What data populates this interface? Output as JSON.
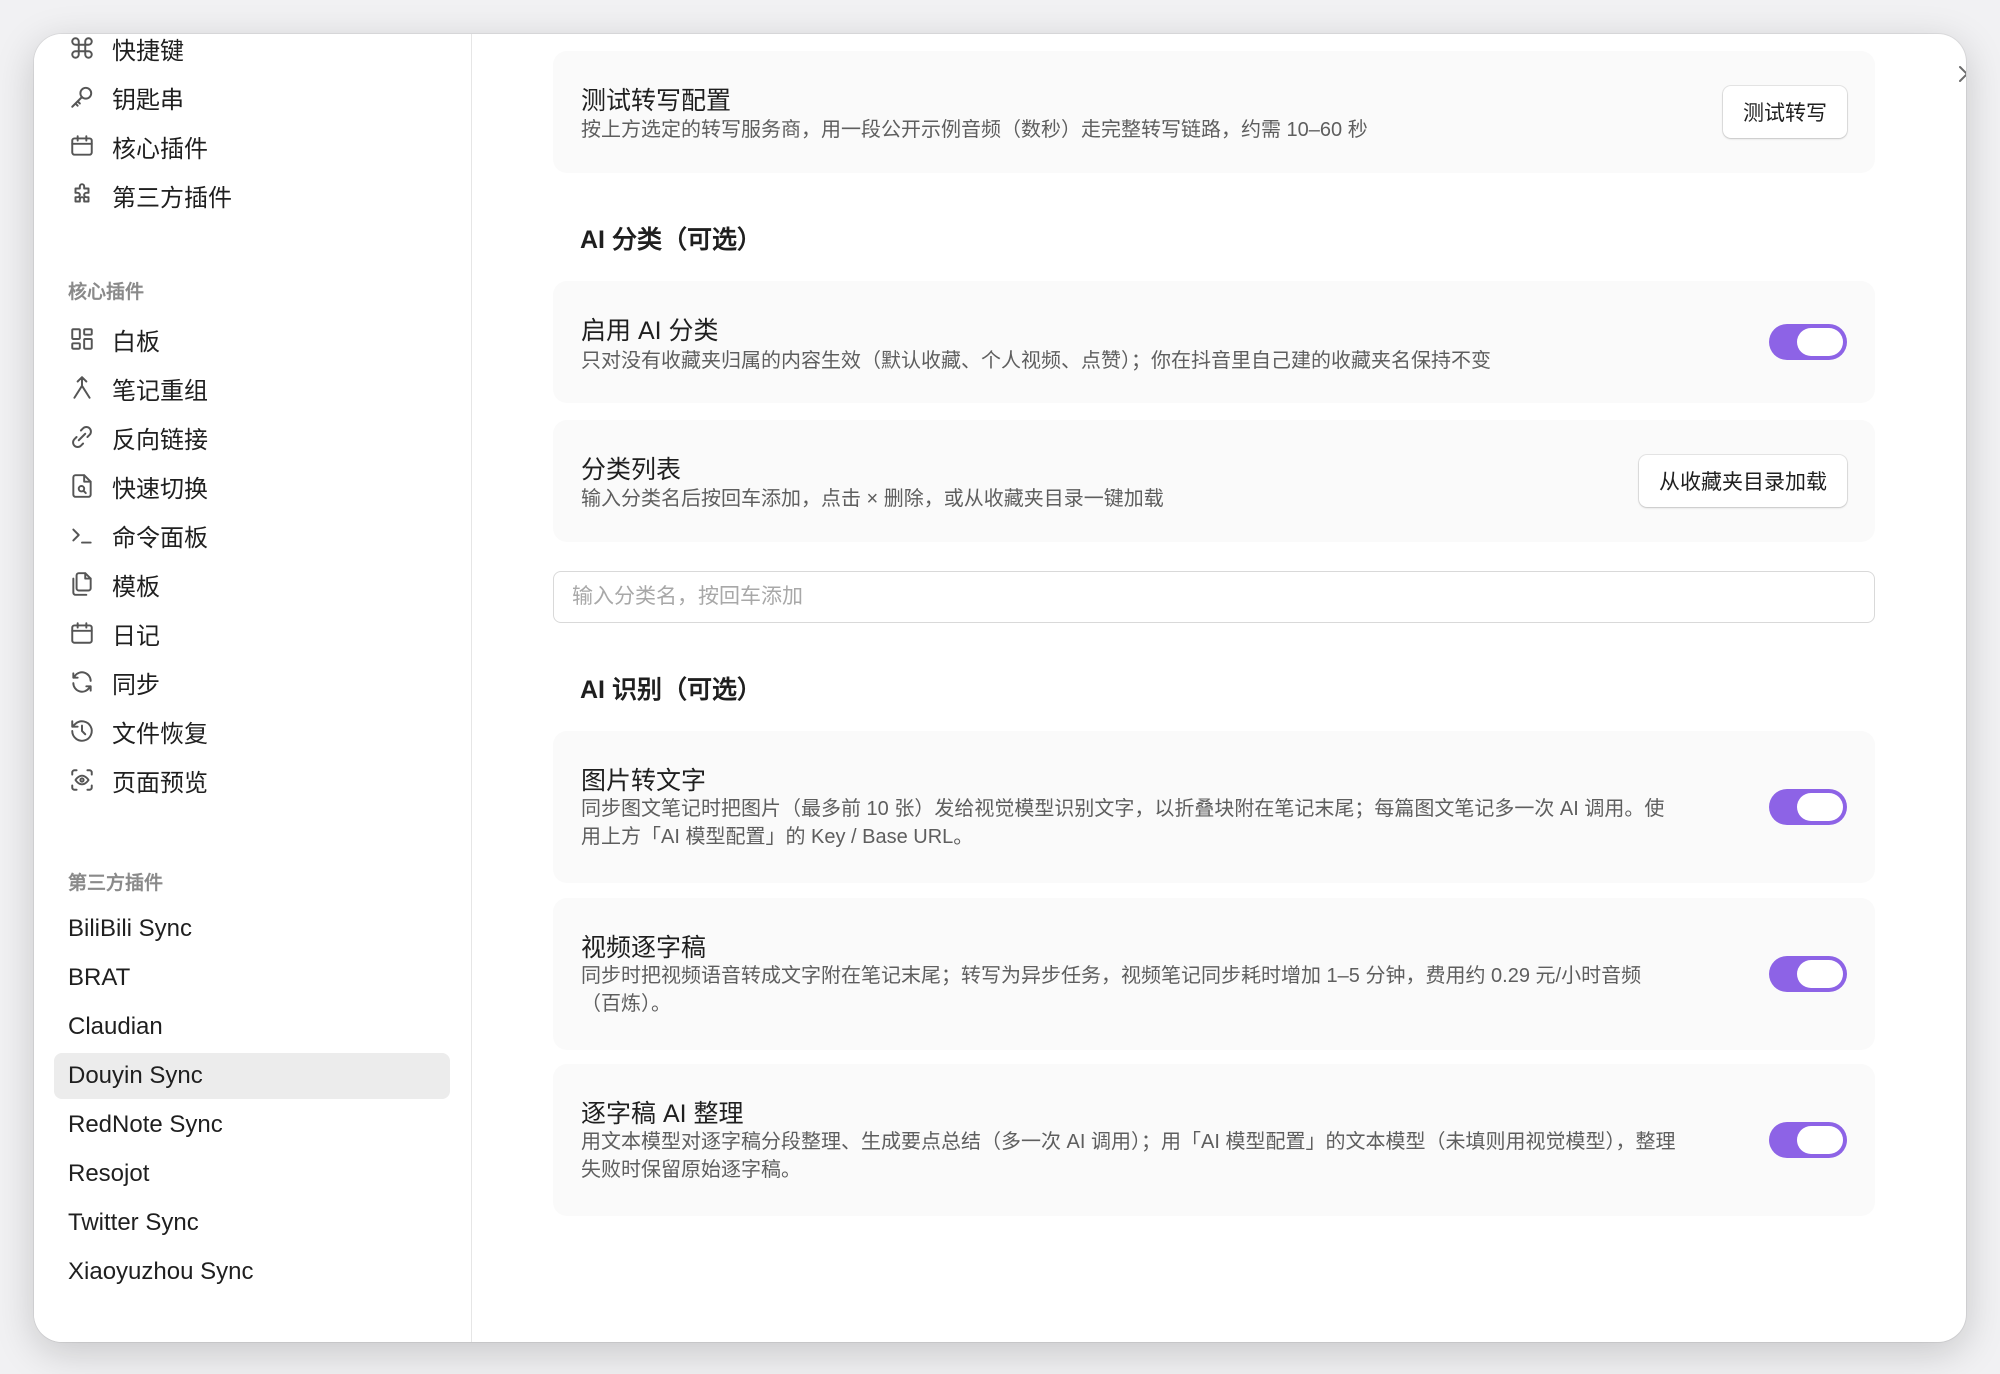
{
  "sidebar": {
    "top_items": [
      {
        "label": "快捷键",
        "icon": "command-icon"
      },
      {
        "label": "钥匙串",
        "icon": "key-icon"
      },
      {
        "label": "核心插件",
        "icon": "calendar-icon"
      },
      {
        "label": "第三方插件",
        "icon": "puzzle-icon"
      }
    ],
    "core_group_title": "核心插件",
    "core_items": [
      {
        "label": "白板",
        "icon": "canvas-icon"
      },
      {
        "label": "笔记重组",
        "icon": "merge-icon"
      },
      {
        "label": "反向链接",
        "icon": "backlink-icon"
      },
      {
        "label": "快速切换",
        "icon": "file-search-icon"
      },
      {
        "label": "命令面板",
        "icon": "terminal-icon"
      },
      {
        "label": "模板",
        "icon": "files-icon"
      },
      {
        "label": "日记",
        "icon": "calendar-icon"
      },
      {
        "label": "同步",
        "icon": "refresh-icon"
      },
      {
        "label": "文件恢复",
        "icon": "history-icon"
      },
      {
        "label": "页面预览",
        "icon": "scan-eye-icon"
      }
    ],
    "third_group_title": "第三方插件",
    "third_items": [
      {
        "label": "BiliBili Sync"
      },
      {
        "label": "BRAT"
      },
      {
        "label": "Claudian"
      },
      {
        "label": "Douyin Sync",
        "selected": true
      },
      {
        "label": "RedNote Sync"
      },
      {
        "label": "Resojot"
      },
      {
        "label": "Twitter Sync"
      },
      {
        "label": "Xiaoyuzhou Sync"
      }
    ]
  },
  "main": {
    "test_transcribe": {
      "title": "测试转写配置",
      "desc": "按上方选定的转写服务商，用一段公开示例音频（数秒）走完整转写链路，约需 10–60 秒",
      "button": "测试转写"
    },
    "ai_classify_heading": "AI 分类（可选）",
    "enable_ai_classify": {
      "title": "启用 AI 分类",
      "desc": "只对没有收藏夹归属的内容生效（默认收藏、个人视频、点赞）；你在抖音里自己建的收藏夹名保持不变",
      "enabled": true
    },
    "category_list": {
      "title": "分类列表",
      "desc": "输入分类名后按回车添加，点击 × 删除，或从收藏夹目录一键加载",
      "button": "从收藏夹目录加载"
    },
    "category_input": {
      "placeholder": "输入分类名，按回车添加",
      "value": ""
    },
    "ai_recognize_heading": "AI 识别（可选）",
    "image_to_text": {
      "title": "图片转文字",
      "desc_line1": "同步图文笔记时把图片（最多前 10 张）发给视觉模型识别文字，以折叠块附在笔记末尾；每篇图文笔记多一次 AI 调用。使",
      "desc_line2": "用上方「AI 模型配置」的 Key / Base URL。",
      "enabled": true
    },
    "video_transcript": {
      "title": "视频逐字稿",
      "desc_line1": "同步时把视频语音转成文字附在笔记末尾；转写为异步任务，视频笔记同步耗时增加 1–5 分钟，费用约 0.29 元/小时音频",
      "desc_line2": "（百炼）。",
      "enabled": true
    },
    "transcript_ai": {
      "title": "逐字稿 AI 整理",
      "desc_line1": "用文本模型对逐字稿分段整理、生成要点总结（多一次 AI 调用）；用「AI 模型配置」的文本模型（未填则用视觉模型），整理",
      "desc_line2": "失败时保留原始逐字稿。",
      "enabled": true
    }
  },
  "colors": {
    "accent": "#8d63e6",
    "selected_bg": "#ececec",
    "card_bg": "#fafafa"
  }
}
